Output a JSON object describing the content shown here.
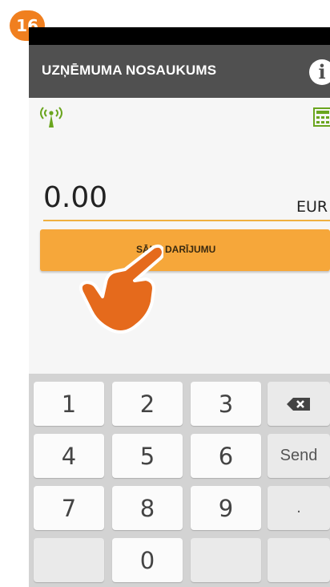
{
  "badge": {
    "step": "16"
  },
  "header": {
    "title": "UZŅĒMUMA NOSAUKUMS",
    "info_icon": "info-icon"
  },
  "icons": {
    "signal": "signal-icon",
    "calculator": "calculator-icon",
    "hand": "pointing-hand-icon",
    "backspace": "backspace-icon"
  },
  "amount": {
    "value": "0.00",
    "currency": "EUR"
  },
  "start_button": {
    "label": "SĀKT DARĪJUMU"
  },
  "keypad": {
    "k1": "1",
    "k2": "2",
    "k3": "3",
    "k4": "4",
    "k5": "5",
    "k6": "6",
    "k7": "7",
    "k8": "8",
    "k9": "9",
    "k0": "0",
    "send": "Send",
    "dot": "."
  },
  "colors": {
    "accent": "#f6a73a",
    "badge": "#f07f1f",
    "appbar": "#505050",
    "icon_green": "#6aa51e"
  }
}
